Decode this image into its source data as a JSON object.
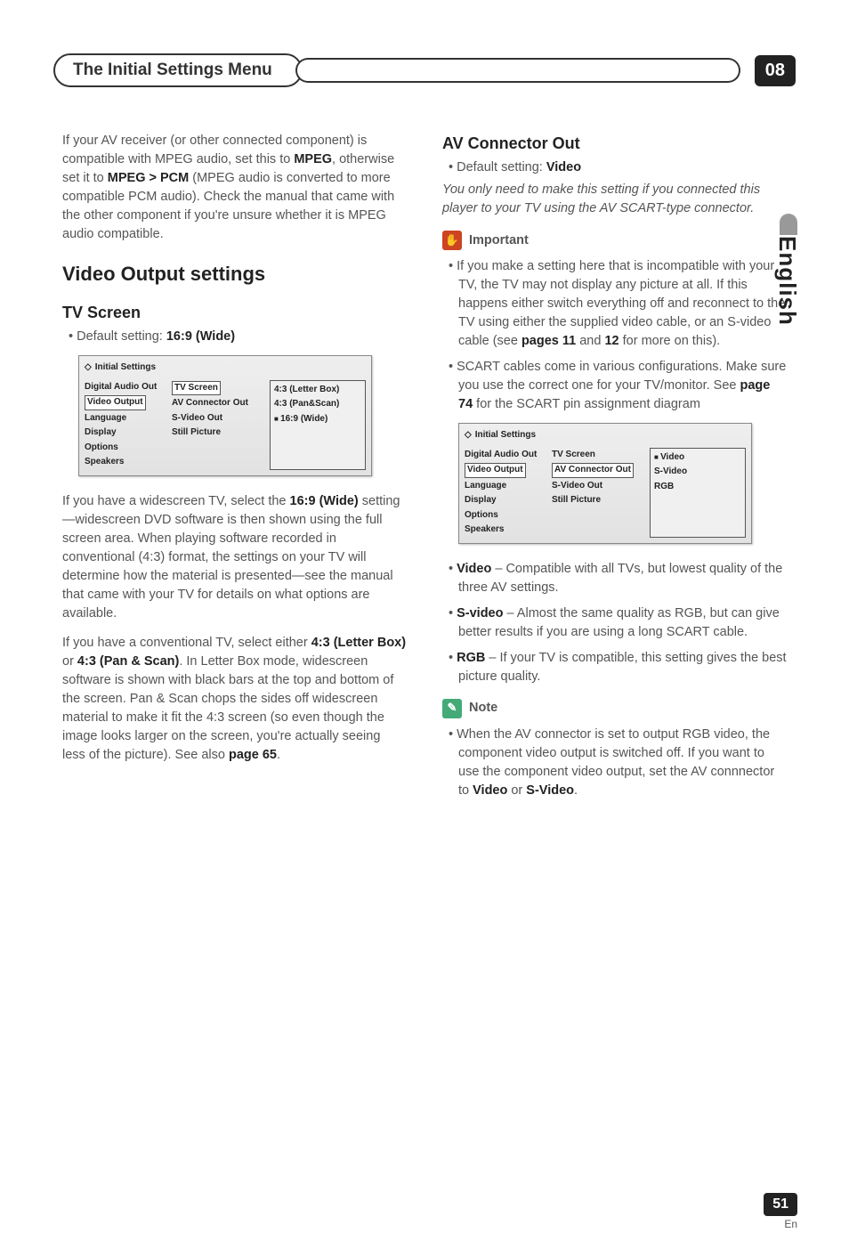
{
  "header": {
    "title": "The Initial Settings Menu",
    "chapter": "08"
  },
  "side_tab": "English",
  "left": {
    "intro_para": "If your AV receiver (or other connected component) is compatible with MPEG audio, set this to ",
    "intro_k1": "MPEG",
    "intro_mid": ", otherwise set it to ",
    "intro_k2": "MPEG > PCM",
    "intro_tail": " (MPEG audio is converted to more compatible PCM audio). Check the manual that came with the other component if you're unsure whether it is MPEG audio compatible.",
    "h2": "Video Output settings",
    "h3": "TV Screen",
    "default_label": "Default setting: ",
    "default_val": "16:9 (Wide)",
    "osd1": {
      "title": "Initial Settings",
      "c1": [
        "Digital Audio Out",
        "Video Output",
        "Language",
        "Display",
        "Options",
        "Speakers"
      ],
      "c2": [
        "TV Screen",
        "AV Connector Out",
        "S-Video Out",
        "Still Picture"
      ],
      "c3": [
        "4:3 (Letter Box)",
        "4:3 (Pan&Scan)",
        "16:9 (Wide)"
      ],
      "c2_selected_index": 0,
      "c3_marked_index": 2
    },
    "para2_a": "If you have a widescreen TV, select the ",
    "para2_k": "16:9 (Wide)",
    "para2_b": " setting—widescreen DVD software is then shown using the full screen area. When playing software recorded in conventional (4:3) format, the settings on your TV will determine how the material is presented—see the manual that came with your TV for details on what options are available.",
    "para3_a": "If you have a conventional TV, select either ",
    "para3_k1": "4:3 (Letter Box)",
    "para3_mid": " or ",
    "para3_k2": "4:3 (Pan & Scan)",
    "para3_b": ". In Letter Box mode, widescreen software is shown with black bars at the top and bottom of the screen. Pan & Scan chops the sides off widescreen material to make it fit the 4:3 screen (so even though the image looks larger on the screen, you're actually seeing less of the picture). See also ",
    "para3_k3": "page 65",
    "para3_tail": "."
  },
  "right": {
    "h3": "AV Connector Out",
    "default_label": "Default setting: ",
    "default_val": "Video",
    "italic_note": "You only need to make this setting if you connected this player to your TV using the AV SCART-type connector.",
    "important_label": "Important",
    "imp_items": [
      {
        "a": "If you make a setting here that is incompatible with your TV, the TV may not display any picture at all. If this happens either switch everything off and reconnect to the TV using either the supplied video cable, or an S-video cable (see ",
        "k": "pages 11",
        "mid": " and ",
        "k2": "12",
        "b": " for more on this)."
      },
      {
        "a": "SCART cables come in various configurations. Make sure you use the correct one for your TV/monitor. See ",
        "k": "page 74",
        "mid": "",
        "k2": "",
        "b": " for the SCART pin assignment diagram"
      }
    ],
    "osd2": {
      "title": "Initial Settings",
      "c1": [
        "Digital Audio Out",
        "Video Output",
        "Language",
        "Display",
        "Options",
        "Speakers"
      ],
      "c2": [
        "TV Screen",
        "AV Connector Out",
        "S-Video Out",
        "Still Picture"
      ],
      "c3": [
        "Video",
        "S-Video",
        "RGB"
      ],
      "c2_selected_index": 1,
      "c3_marked_index": 0
    },
    "opts": [
      {
        "k": "Video",
        "t": " – Compatible with all TVs, but lowest quality of the three AV settings."
      },
      {
        "k": "S-video",
        "t": " – Almost the same quality as RGB, but can give better results if you are using a long SCART cable."
      },
      {
        "k": "RGB",
        "t": " – If your TV is compatible, this setting gives the best picture quality."
      }
    ],
    "note_label": "Note",
    "note_a": "When the AV connector is set to output RGB video, the component video output is switched off. If you want to use the component video output, set the AV connnector to ",
    "note_k1": "Video",
    "note_mid": " or ",
    "note_k2": "S-Video",
    "note_tail": "."
  },
  "footer": {
    "page": "51",
    "lang": "En"
  }
}
